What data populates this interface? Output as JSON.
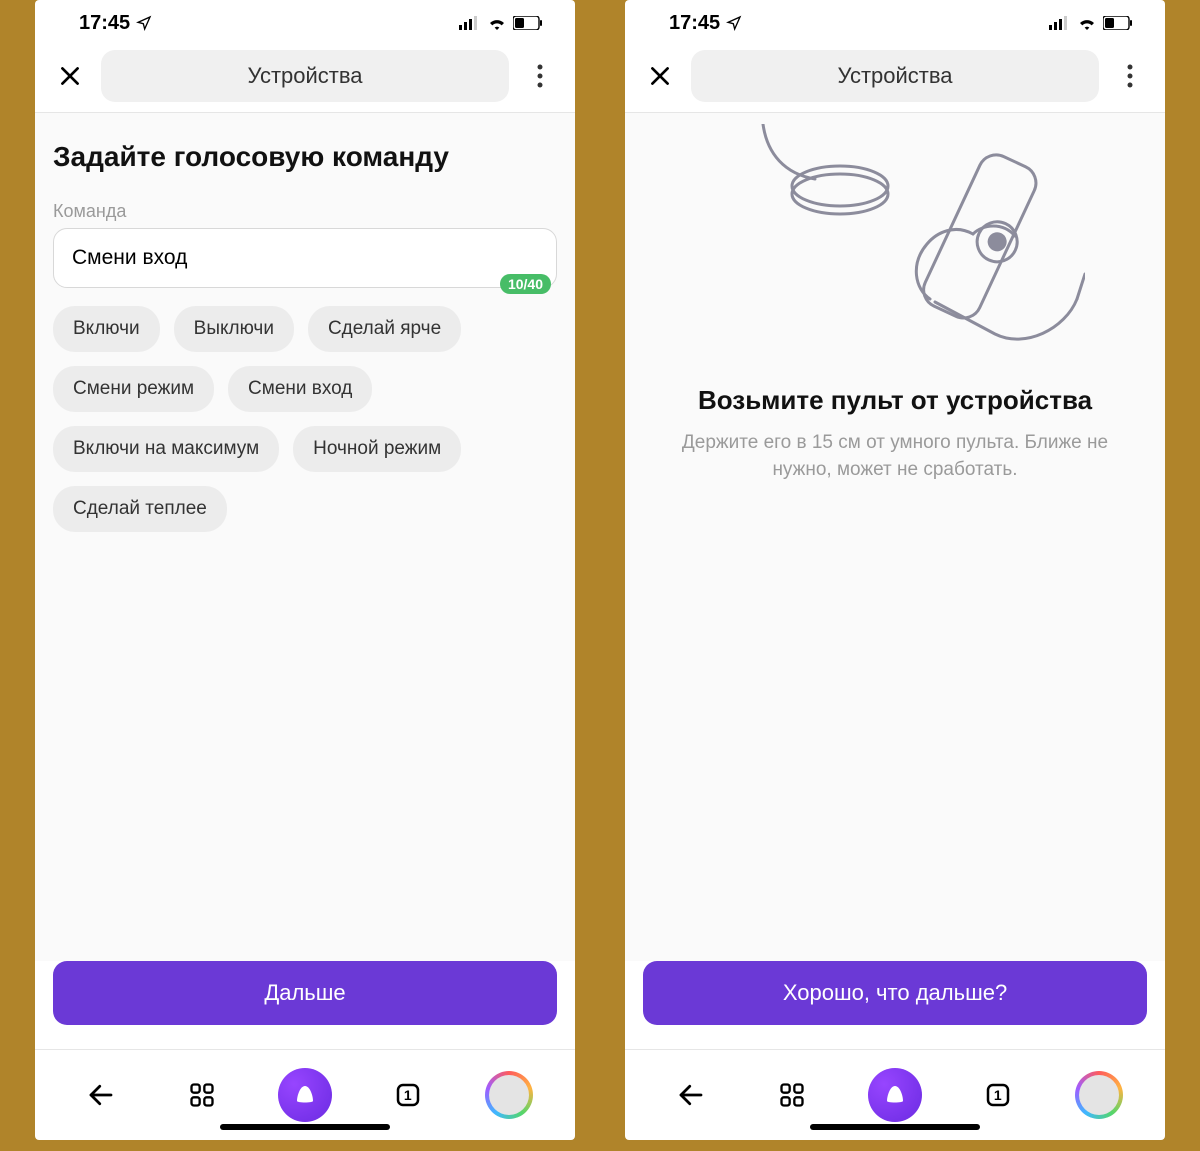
{
  "statusbar": {
    "time": "17:45"
  },
  "header": {
    "title": "Устройства"
  },
  "screenA": {
    "page_title": "Задайте голосовую команду",
    "field_label": "Команда",
    "input_value": "Смени вход",
    "counter": "10/40",
    "chips": [
      "Включи",
      "Выключи",
      "Сделай ярче",
      "Смени режим",
      "Смени вход",
      "Включи на максимум",
      "Ночной режим",
      "Сделай теплее"
    ],
    "primary": "Дальше"
  },
  "screenB": {
    "title": "Возьмите пульт от устройства",
    "subtitle": "Держите его в 15 см от умного пульта. Ближе не нужно, может не сработать.",
    "primary": "Хорошо, что дальше?"
  },
  "tabbar": {
    "tab_count": "1"
  }
}
